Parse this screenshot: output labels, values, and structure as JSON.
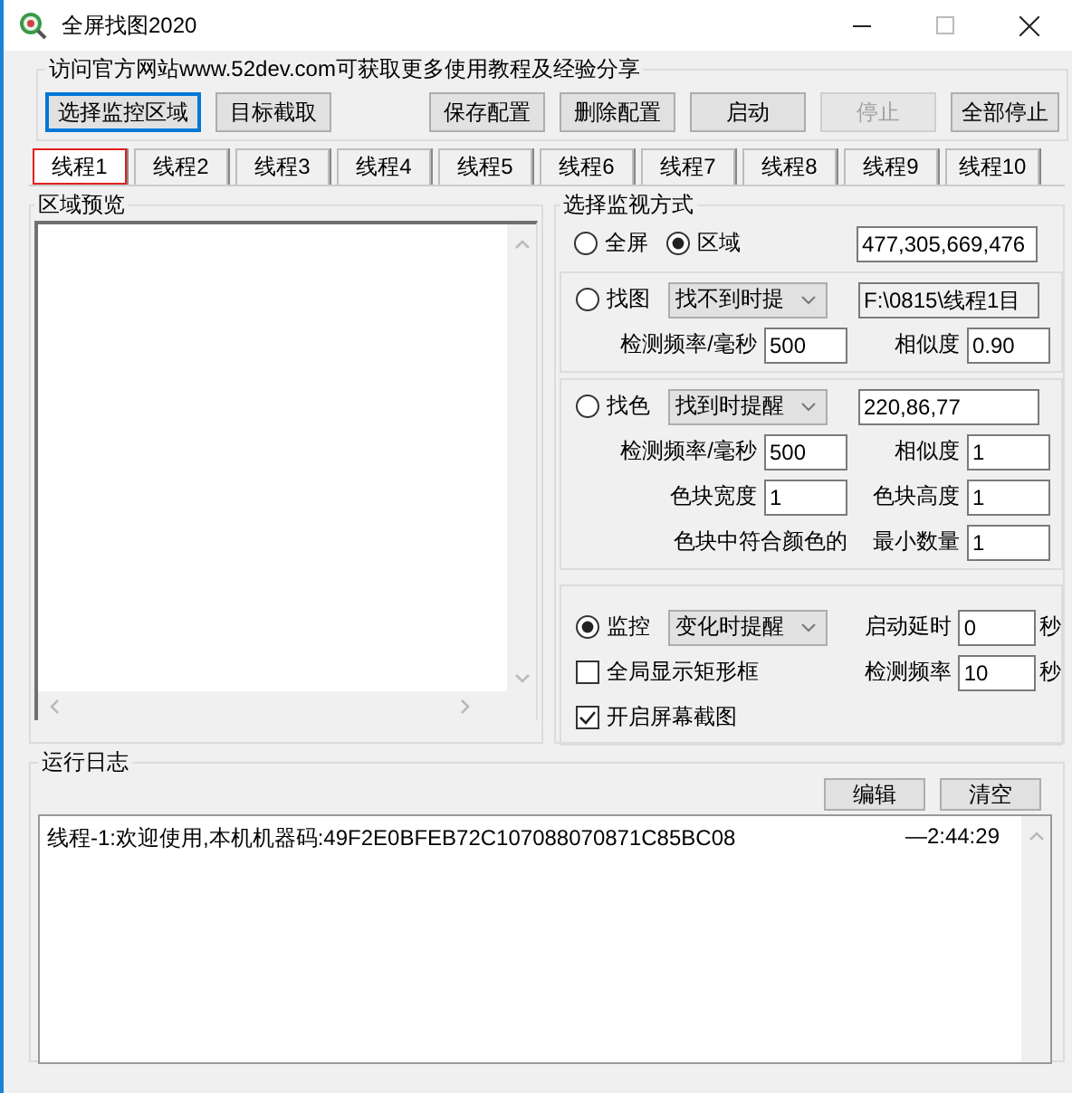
{
  "window": {
    "title": "全屏找图2020"
  },
  "header": {
    "notice": "访问官方网站www.52dev.com可获取更多使用教程及经验分享",
    "buttons": [
      {
        "label": "选择监控区域",
        "focused": true,
        "disabled": false
      },
      {
        "label": "目标截取",
        "focused": false,
        "disabled": false
      },
      {
        "label": "保存配置",
        "focused": false,
        "disabled": false
      },
      {
        "label": "删除配置",
        "focused": false,
        "disabled": false
      },
      {
        "label": "启动",
        "focused": false,
        "disabled": false
      },
      {
        "label": "停止",
        "focused": false,
        "disabled": true
      },
      {
        "label": "全部停止",
        "focused": false,
        "disabled": false
      }
    ]
  },
  "tabs": [
    {
      "label": "线程1",
      "selected": true
    },
    {
      "label": "线程2",
      "selected": false
    },
    {
      "label": "线程3",
      "selected": false
    },
    {
      "label": "线程4",
      "selected": false
    },
    {
      "label": "线程5",
      "selected": false
    },
    {
      "label": "线程6",
      "selected": false
    },
    {
      "label": "线程7",
      "selected": false
    },
    {
      "label": "线程8",
      "selected": false
    },
    {
      "label": "线程9",
      "selected": false
    },
    {
      "label": "线程10",
      "selected": false
    }
  ],
  "preview": {
    "title": "区域预览"
  },
  "monitor": {
    "title": "选择监视方式",
    "scope_options": [
      {
        "label": "全屏",
        "selected": false
      },
      {
        "label": "区域",
        "selected": true
      }
    ],
    "region": "477,305,669,476",
    "sections": [
      {
        "kind": "image",
        "option": {
          "label": "找图",
          "selected": false
        },
        "mode": "找不到时提",
        "right": {
          "kind": "input",
          "value": "F:\\0815\\线程1目"
        },
        "rows": [
          [
            {
              "kind": "field",
              "label": "检测频率/毫秒",
              "value": "500"
            },
            {
              "kind": "field",
              "label": "相似度",
              "value": "0.90"
            }
          ]
        ]
      },
      {
        "kind": "color",
        "option": {
          "label": "找色",
          "selected": false
        },
        "mode": "找到时提醒",
        "right": {
          "kind": "input",
          "value": "220,86,77"
        },
        "rows": [
          [
            {
              "kind": "field",
              "label": "检测频率/毫秒",
              "value": "500"
            },
            {
              "kind": "field",
              "label": "相似度",
              "value": "1"
            }
          ],
          [
            {
              "kind": "field",
              "label": "色块宽度",
              "value": "1"
            },
            {
              "kind": "field",
              "label": "色块高度",
              "value": "1"
            }
          ],
          [
            {
              "kind": "text",
              "label": "色块中符合颜色的"
            },
            {
              "kind": "field",
              "label": "最小数量",
              "value": "1"
            }
          ]
        ]
      },
      {
        "kind": "watch",
        "option": {
          "label": "监控",
          "selected": true
        },
        "mode": "变化时提醒",
        "right": {
          "kind": "field",
          "label": "启动延时",
          "value": "0",
          "unit": "秒"
        },
        "rows": [
          [
            {
              "kind": "checkbox",
              "label": "全局显示矩形框",
              "checked": false
            },
            {
              "kind": "field",
              "label": "检测频率",
              "value": "10",
              "unit": "秒"
            }
          ],
          [
            {
              "kind": "checkbox",
              "label": "开启屏幕截图",
              "checked": true
            }
          ]
        ]
      }
    ]
  },
  "log": {
    "title": "运行日志",
    "buttons": [
      "编辑",
      "清空"
    ],
    "entries": [
      {
        "message": "线程-1:欢迎使用,本机机器码:49F2E0BFEB72C107088070871C85BC08",
        "time": "—2:44:29"
      }
    ]
  }
}
